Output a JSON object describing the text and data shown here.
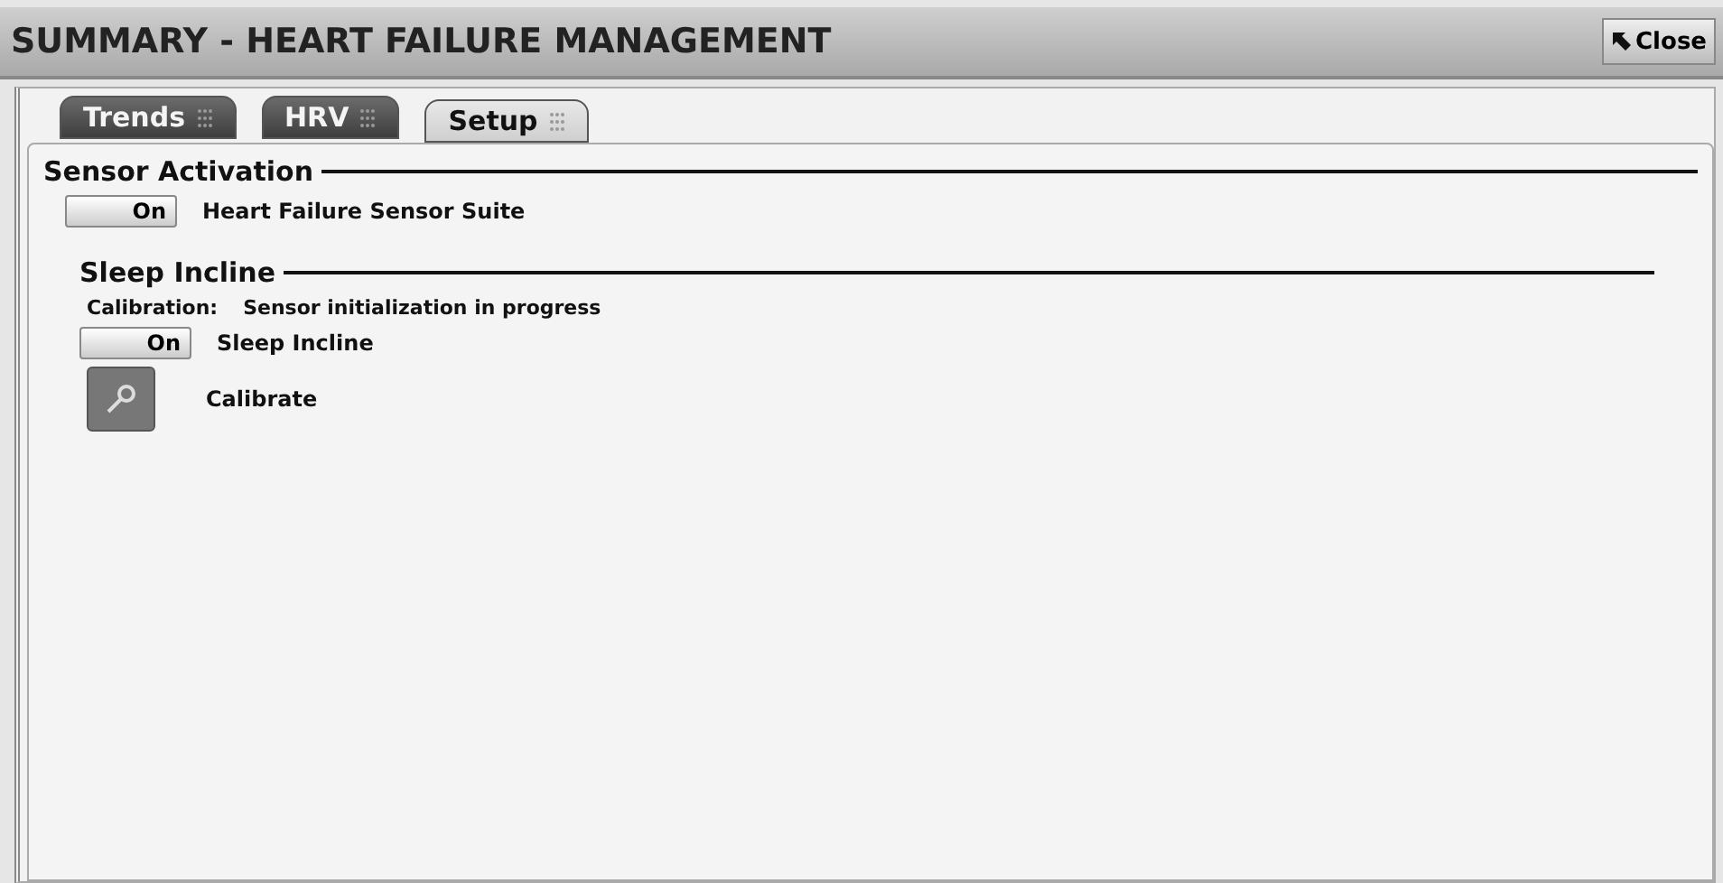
{
  "window": {
    "title": "SUMMARY - HEART FAILURE MANAGEMENT",
    "close_button": "Close"
  },
  "tabs": [
    {
      "label": "Trends",
      "selected": false
    },
    {
      "label": "HRV",
      "selected": false
    },
    {
      "label": "Setup",
      "selected": true
    }
  ],
  "sensor_activation": {
    "heading": "Sensor Activation",
    "toggle": {
      "label": "On",
      "on": true
    },
    "toggle_label": "Heart Failure Sensor Suite"
  },
  "sleep_incline": {
    "heading": "Sleep Incline",
    "calibration_label": "Calibration:",
    "calibration_status": "Sensor initialization in progress",
    "toggle": {
      "label": "On",
      "on": true
    },
    "toggle_label": "Sleep Incline",
    "calibrate_button": "Calibrate"
  }
}
